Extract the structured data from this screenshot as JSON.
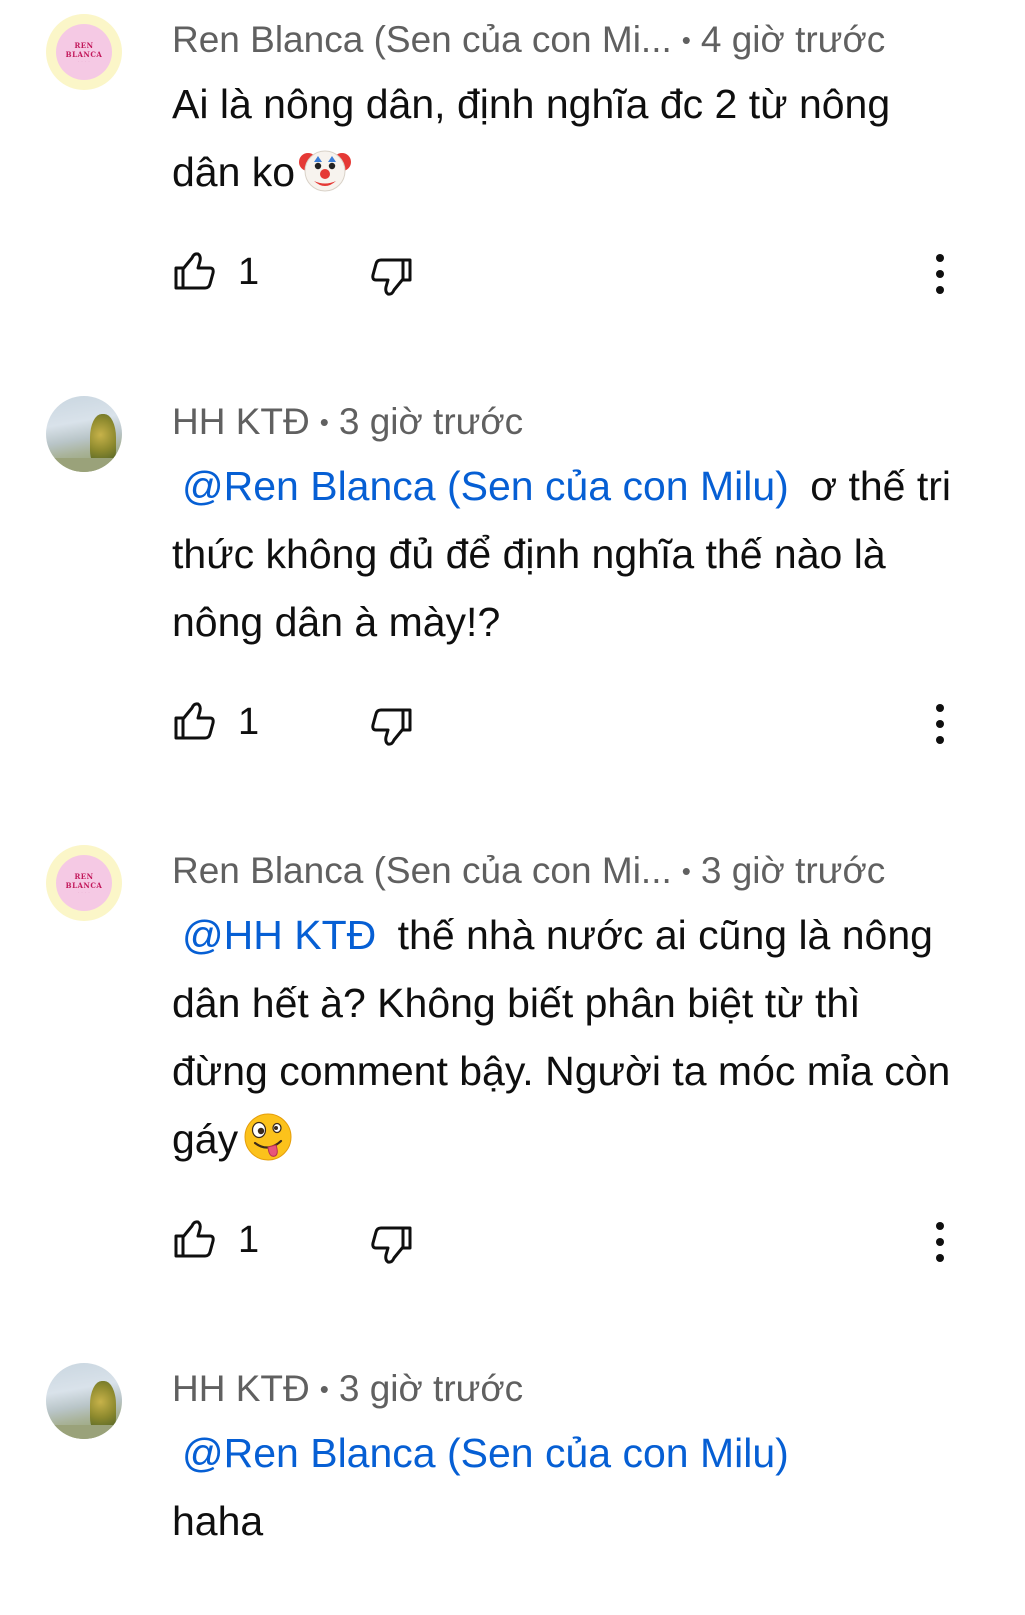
{
  "comments": [
    {
      "author": "Ren Blanca (Sen của con Mi...",
      "time": "4 giờ trước",
      "avatar": {
        "label_top": "REN",
        "label_bottom": "BLANCA"
      },
      "mention": "",
      "text": "Ai là nông dân, định nghĩa đc 2 từ nông dân ko",
      "emoji": "clown-face",
      "likes": "1"
    },
    {
      "author": "HH KTĐ",
      "time": "3 giờ trước",
      "mention": "@Ren Blanca (Sen của con Milu)",
      "text": "ơ thế tri thức không đủ để định nghĩa thế nào là nông dân à mày!?",
      "likes": "1"
    },
    {
      "author": "Ren Blanca (Sen của con Mi...",
      "time": "3 giờ trước",
      "avatar": {
        "label_top": "REN",
        "label_bottom": "BLANCA"
      },
      "mention": "@HH KTĐ",
      "text": "thế nhà nước ai cũng là nông dân hết à? Không biết phân biệt từ thì đừng comment bậy. Người ta móc mỉa còn gáy",
      "emoji": "zany-face",
      "likes": "1"
    },
    {
      "author": "HH KTĐ",
      "time": "3 giờ trước",
      "mention": "@Ren Blanca (Sen của con Milu)",
      "text": "haha"
    }
  ],
  "separator": "•",
  "colors": {
    "meta_text": "#606060",
    "mention": "#065fd4",
    "body_text": "#0f0f0f"
  }
}
